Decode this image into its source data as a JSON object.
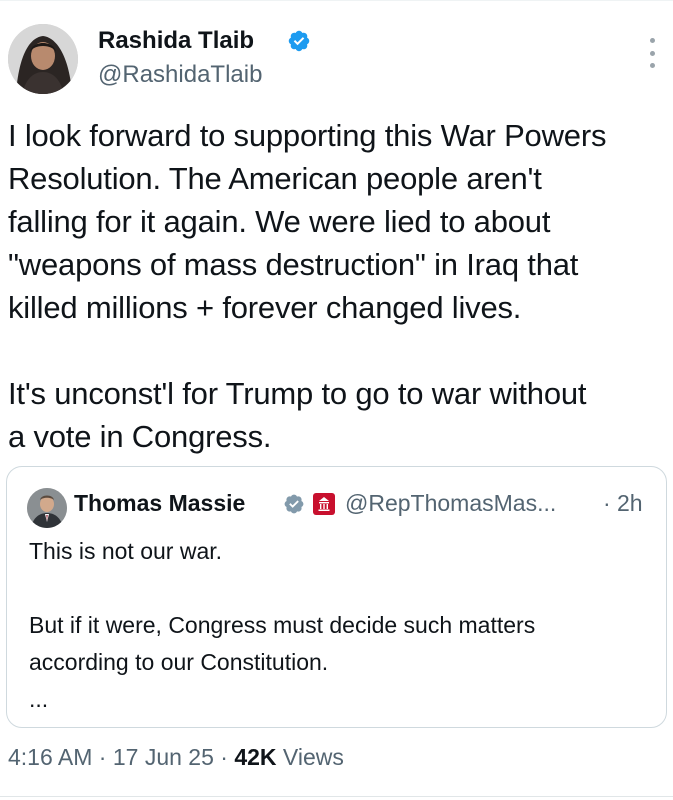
{
  "author": {
    "name": "Rashida Tlaib",
    "handle": "@RashidaTlaib",
    "verified": true,
    "avatar_icon": "person-photo-icon"
  },
  "tweet": {
    "text": "I look forward to supporting this War Powers\nResolution. The American people aren't\nfalling for it again. We were lied to about\n\"weapons of mass destruction\" in Iraq that\nkilled millions + forever changed lives.\n\nIt's unconst'l for Trump to go to war without\na vote in Congress."
  },
  "quote": {
    "name": "Thomas Massie",
    "handle": "@RepThomasMas...",
    "separator": "·",
    "time": "2h",
    "text": "This is not our war.\n\nBut if it were, Congress must decide such matters\naccording to our Constitution.\n...",
    "verified_color": "#829aab",
    "affiliation_badge_color": "#c8102e"
  },
  "meta": {
    "time": "4:16 AM",
    "sep1": " · ",
    "date": "17 Jun 25",
    "sep2": " · ",
    "views_count": "42K",
    "views_label": " Views"
  },
  "colors": {
    "verified_blue": "#1d9bf0",
    "text_primary": "#0f1419",
    "text_secondary": "#536471",
    "border": "#cfd9de"
  }
}
